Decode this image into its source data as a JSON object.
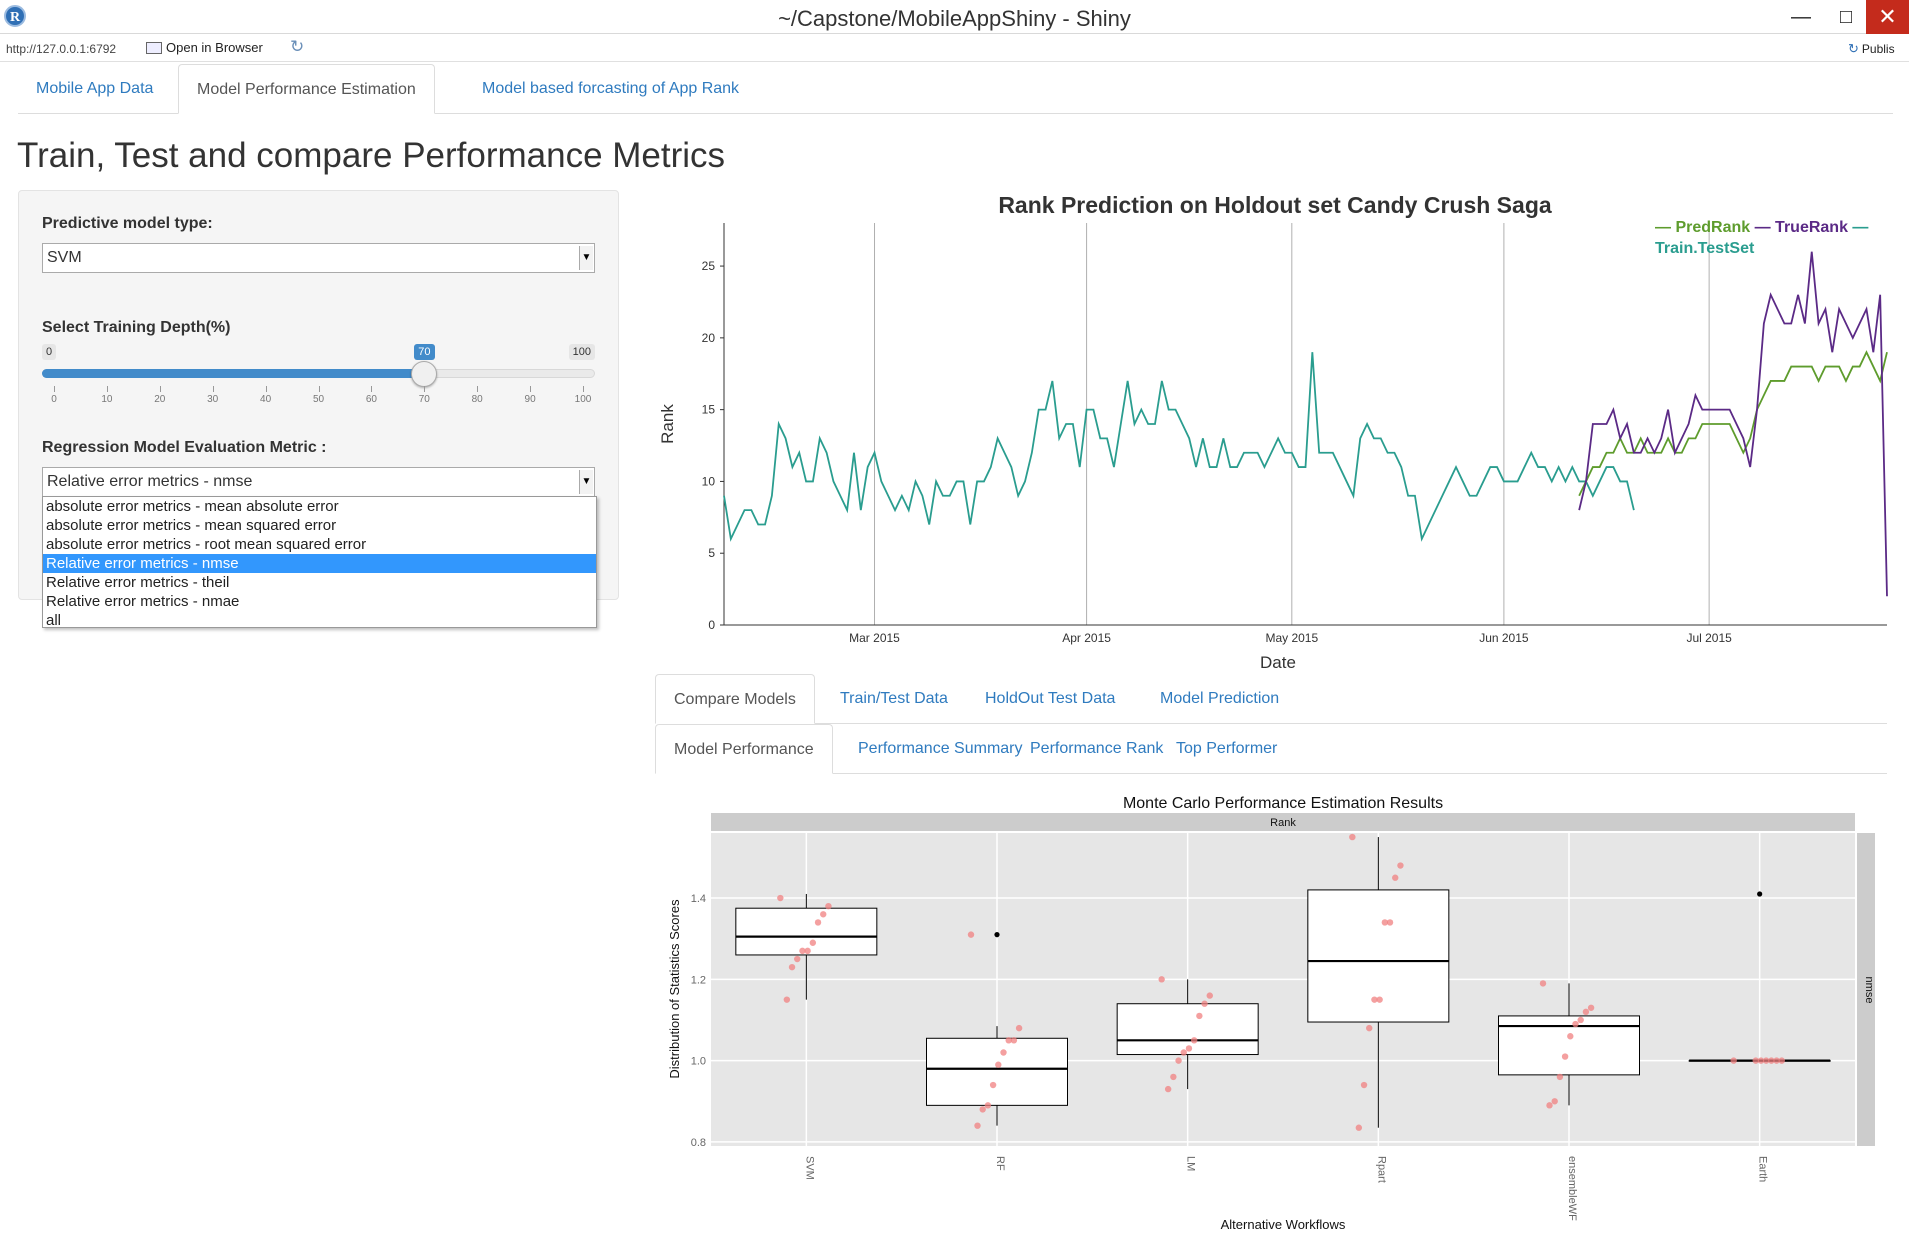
{
  "window": {
    "title": "~/Capstone/MobileAppShiny - Shiny",
    "logo": "R",
    "minimize": "—",
    "maximize": "□",
    "close": "✕"
  },
  "address_bar": {
    "url": "http://127.0.0.1:6792",
    "open_in_browser": "Open in Browser",
    "publish": "Publis"
  },
  "tabs": [
    {
      "label": "Mobile App Data"
    },
    {
      "label": "Model Performance Estimation"
    },
    {
      "label": "Model based forcasting of App Rank"
    }
  ],
  "page_title": "Train, Test and compare Performance Metrics",
  "sidebar": {
    "model_type_label": "Predictive model type:",
    "model_type_value": "SVM",
    "training_depth_label": "Select Training Depth(%)",
    "slider": {
      "min": 0,
      "max": 100,
      "value": 70,
      "min_label": "0",
      "max_label": "100",
      "value_label": "70",
      "ticks": [
        "0",
        "10",
        "20",
        "30",
        "40",
        "50",
        "60",
        "70",
        "80",
        "90",
        "100"
      ]
    },
    "metric_label": "Regression Model Evaluation Metric :",
    "metric_value": "Relative error metrics - nmse",
    "metric_options": [
      "absolute error metrics - mean absolute error",
      "absolute error metrics - mean squared error",
      "absolute error metrics - root mean squared error",
      "Relative error metrics - nmse",
      "Relative error metrics - theil",
      "Relative error metrics - nmae",
      "all"
    ],
    "metric_selected_index": 3
  },
  "subtabs_1": [
    {
      "label": "Compare Models"
    },
    {
      "label": "Train/Test Data"
    },
    {
      "label": "HoldOut Test Data"
    },
    {
      "label": "Model Prediction"
    }
  ],
  "subtabs_2": [
    {
      "label": "Model Performance"
    },
    {
      "label": "Performance Summary"
    },
    {
      "label": "Performance Rank"
    },
    {
      "label": "Top Performer"
    }
  ],
  "chart_data": [
    {
      "type": "line",
      "title": "Rank Prediction on Holdout set Candy Crush Saga",
      "xlabel": "Date",
      "ylabel": "Rank",
      "ylim": [
        0,
        28
      ],
      "yticks": [
        0,
        5,
        10,
        15,
        20,
        25
      ],
      "xlim": [
        "2015-02-07",
        "2015-07-27"
      ],
      "xticks": [
        {
          "date": "2015-03-01",
          "label": "Mar 2015"
        },
        {
          "date": "2015-04-01",
          "label": "Apr 2015"
        },
        {
          "date": "2015-05-01",
          "label": "May 2015"
        },
        {
          "date": "2015-06-01",
          "label": "Jun 2015"
        },
        {
          "date": "2015-07-01",
          "label": "Jul 2015"
        }
      ],
      "grid": true,
      "legend": "top-right",
      "legend_text": {
        "dash": "—",
        "pred": "PredRank",
        "true": "TrueRank",
        "train": "Train.TestSet"
      },
      "series": [
        {
          "name": "Train.TestSet",
          "color": "#2a9d8f",
          "start": "2015-02-07",
          "values": [
            9,
            6,
            7,
            8,
            8,
            7,
            7,
            9,
            14,
            13,
            11,
            12,
            10,
            10,
            13,
            12,
            10,
            9,
            8,
            12,
            8,
            11,
            12,
            10,
            9,
            8,
            9,
            8,
            10,
            9,
            7,
            10,
            9,
            9,
            10,
            10,
            7,
            10,
            10,
            11,
            13,
            12,
            11,
            9,
            10,
            12,
            15,
            15,
            17,
            13,
            14,
            14,
            11,
            15,
            15,
            13,
            13,
            11,
            14,
            17,
            14,
            15,
            14,
            14,
            17,
            15,
            15,
            14,
            13,
            11,
            13,
            11,
            11,
            13,
            11,
            11,
            12,
            12,
            12,
            11,
            12,
            13,
            12,
            12,
            11,
            11,
            19,
            12,
            12,
            12,
            11,
            10,
            9,
            13,
            14,
            13,
            13,
            12,
            12,
            11,
            9,
            9,
            6,
            7,
            8,
            9,
            10,
            11,
            10,
            9,
            9,
            10,
            11,
            11,
            10,
            10,
            10,
            11,
            12,
            11,
            11,
            10,
            11,
            10,
            11,
            10,
            10,
            9,
            10,
            11,
            11,
            10,
            10,
            8
          ]
        },
        {
          "name": "PredRank",
          "color": "#5e9c2d",
          "start": "2015-06-12",
          "values": [
            9,
            10,
            11,
            11,
            12,
            12,
            13,
            12,
            12,
            13,
            12,
            12,
            12,
            13,
            12,
            12,
            13,
            13,
            14,
            14,
            14,
            14,
            14,
            13,
            12,
            13,
            15,
            16,
            17,
            17,
            17,
            18,
            18,
            18,
            18,
            17,
            18,
            18,
            18,
            17,
            18,
            18,
            19,
            18,
            17,
            19
          ]
        },
        {
          "name": "TrueRank",
          "color": "#5b2a86",
          "start": "2015-06-12",
          "values": [
            8,
            10,
            14,
            14,
            14,
            15,
            13,
            14,
            12,
            12,
            13,
            12,
            13,
            15,
            12,
            13,
            14,
            16,
            15,
            15,
            15,
            15,
            15,
            14,
            13,
            11,
            15,
            21,
            23,
            22,
            21,
            21,
            23,
            21,
            26,
            21,
            22,
            19,
            22,
            21,
            20,
            21,
            22,
            19,
            23,
            2
          ]
        }
      ]
    },
    {
      "type": "box",
      "title": "Monte Carlo Performance Estimation Results",
      "facet_top": "Rank",
      "facet_right": "nmse",
      "xlabel": "Alternative Workflows",
      "ylabel": "Distribution of Statistics Scores",
      "ylim": [
        0.79,
        1.56
      ],
      "yticks": [
        0.8,
        1.0,
        1.2,
        1.4
      ],
      "categories": [
        "SVM",
        "RF",
        "LM",
        "Rpart",
        "ensembleWF",
        "Earth"
      ],
      "boxes": [
        {
          "q1": 1.26,
          "median": 1.305,
          "q3": 1.375,
          "whisker_low": 1.15,
          "whisker_high": 1.41,
          "outliers": [],
          "points": [
            1.4,
            1.38,
            1.36,
            1.34,
            1.29,
            1.27,
            1.27,
            1.25,
            1.23,
            1.15
          ]
        },
        {
          "q1": 0.89,
          "median": 0.98,
          "q3": 1.055,
          "whisker_low": 0.84,
          "whisker_high": 1.085,
          "outliers": [
            1.31
          ],
          "points": [
            1.31,
            1.08,
            1.05,
            1.05,
            1.02,
            0.99,
            0.94,
            0.89,
            0.88,
            0.84
          ]
        },
        {
          "q1": 1.015,
          "median": 1.05,
          "q3": 1.14,
          "whisker_low": 0.93,
          "whisker_high": 1.2,
          "outliers": [],
          "points": [
            1.2,
            1.16,
            1.14,
            1.11,
            1.05,
            1.03,
            1.02,
            1.0,
            0.96,
            0.93
          ]
        },
        {
          "q1": 1.095,
          "median": 1.245,
          "q3": 1.42,
          "whisker_low": 0.835,
          "whisker_high": 1.55,
          "outliers": [],
          "points": [
            1.55,
            1.48,
            1.45,
            1.34,
            1.34,
            1.15,
            1.15,
            1.08,
            0.94,
            0.835
          ]
        },
        {
          "q1": 0.965,
          "median": 1.085,
          "q3": 1.11,
          "whisker_low": 0.89,
          "whisker_high": 1.19,
          "outliers": [],
          "points": [
            1.19,
            1.13,
            1.12,
            1.1,
            1.09,
            1.06,
            1.01,
            0.96,
            0.9,
            0.89
          ]
        },
        {
          "q1": 1.0,
          "median": 1.0,
          "q3": 1.0,
          "whisker_low": 1.0,
          "whisker_high": 1.0,
          "outliers": [
            1.41
          ],
          "points": [
            1.0,
            1.0,
            1.0,
            1.0,
            1.0,
            1.0,
            1.0
          ]
        }
      ],
      "box_color": "#000000",
      "point_color": "#f08080",
      "panel_bg": "#e6e6e6"
    }
  ]
}
